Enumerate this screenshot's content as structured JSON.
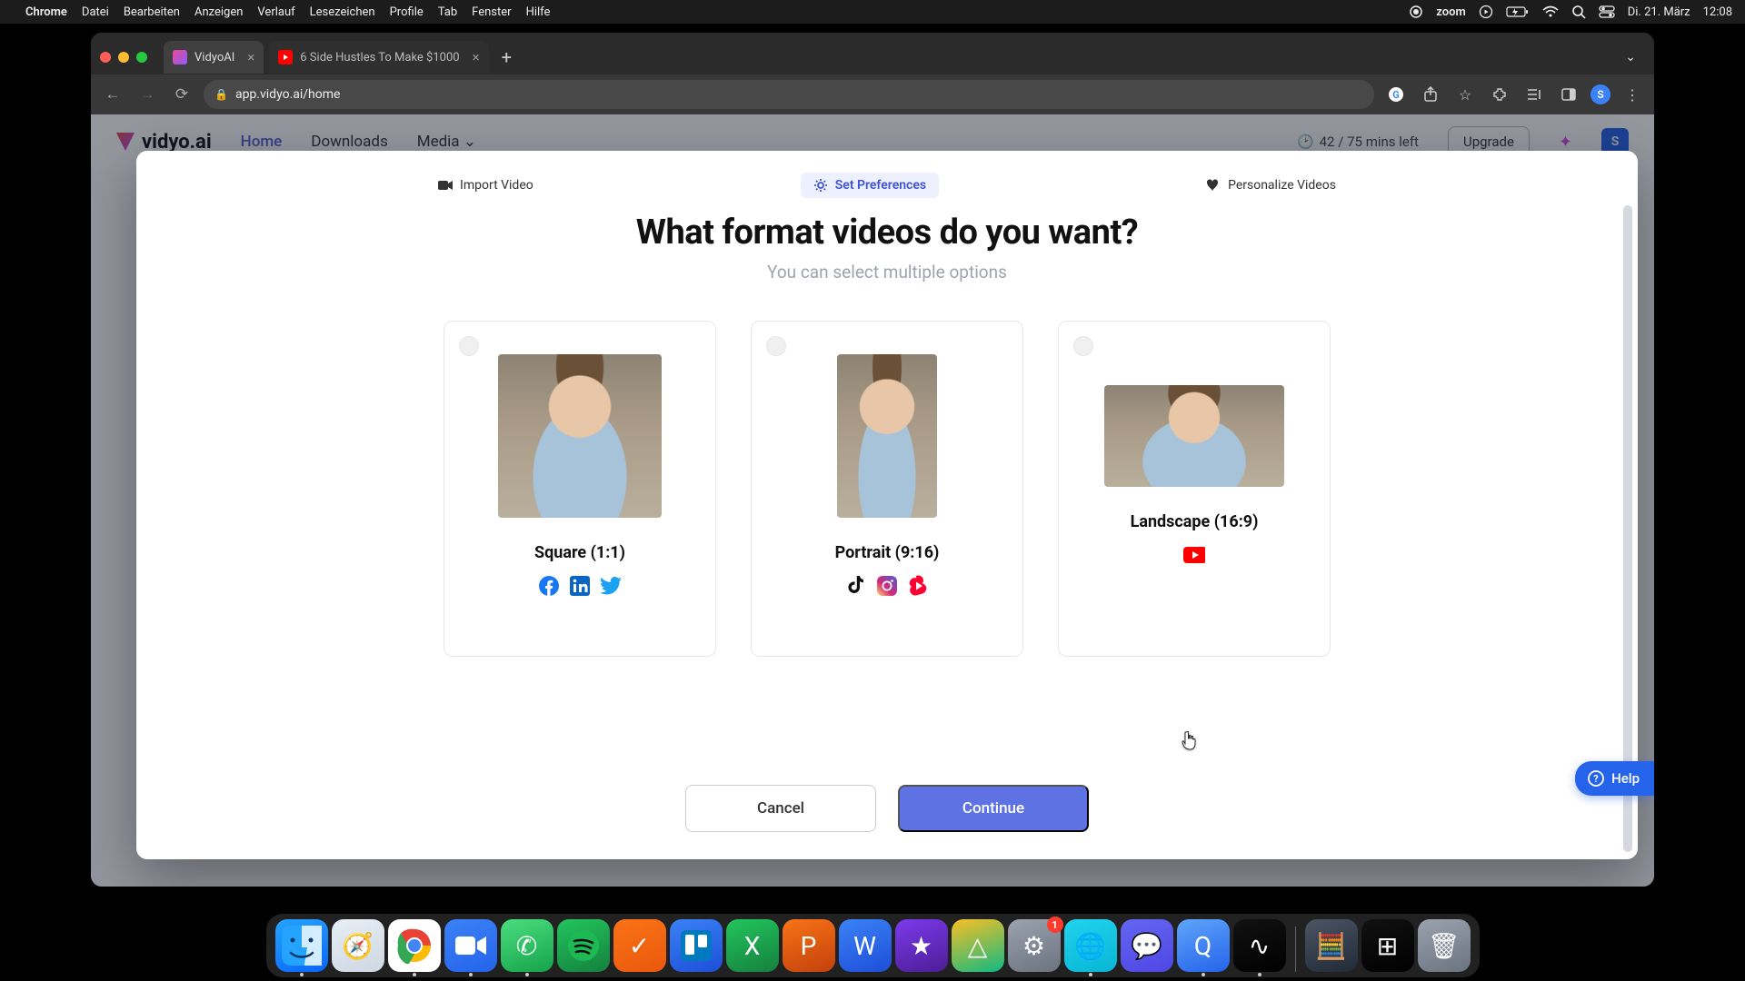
{
  "menubar": {
    "app": "Chrome",
    "items": [
      "Datei",
      "Bearbeiten",
      "Anzeigen",
      "Verlauf",
      "Lesezeichen",
      "Profile",
      "Tab",
      "Fenster",
      "Hilfe"
    ],
    "right": {
      "zoom": "zoom",
      "date": "Di. 21. März",
      "time": "12:08"
    }
  },
  "browser": {
    "tabs": [
      {
        "title": "VidyoAI"
      },
      {
        "title": "6 Side Hustles To Make $1000"
      }
    ],
    "url": "app.vidyo.ai/home",
    "avatar_initial": "S"
  },
  "app_header": {
    "brand": "vidyo.ai",
    "nav": {
      "home": "Home",
      "downloads": "Downloads",
      "media": "Media"
    },
    "mins": "42 / 75 mins left",
    "upgrade": "Upgrade",
    "avatar_initial": "S"
  },
  "modal": {
    "steps": {
      "import": "Import Video",
      "preferences": "Set Preferences",
      "personalize": "Personalize Videos"
    },
    "title": "What format videos do you want?",
    "subtitle": "You can select multiple options",
    "cards": [
      {
        "title": "Square (1:1)",
        "platforms": [
          "facebook",
          "linkedin",
          "twitter"
        ]
      },
      {
        "title": "Portrait (9:16)",
        "platforms": [
          "tiktok",
          "instagram",
          "shorts"
        ]
      },
      {
        "title": "Landscape (16:9)",
        "platforms": [
          "youtube"
        ]
      }
    ],
    "buttons": {
      "cancel": "Cancel",
      "continue": "Continue"
    }
  },
  "help": {
    "label": "Help"
  },
  "dock": {
    "apps": [
      {
        "name": "finder",
        "color1": "#24a4ff",
        "color2": "#0a66ff",
        "running": true,
        "glyph": ""
      },
      {
        "name": "safari",
        "color1": "#e9eef5",
        "color2": "#cdd7e3",
        "running": false,
        "glyph": "🧭"
      },
      {
        "name": "chrome",
        "color1": "#ffffff",
        "color2": "#ffffff",
        "running": true,
        "glyph": ""
      },
      {
        "name": "zoom",
        "color1": "#3b82f6",
        "color2": "#2563eb",
        "running": true,
        "glyph": ""
      },
      {
        "name": "whatsapp",
        "color1": "#4ade80",
        "color2": "#16a34a",
        "running": true,
        "glyph": "✆"
      },
      {
        "name": "spotify",
        "color1": "#22c55e",
        "color2": "#15803d",
        "running": false,
        "glyph": ""
      },
      {
        "name": "todoist",
        "color1": "#f97316",
        "color2": "#ea580c",
        "running": false,
        "glyph": "✓"
      },
      {
        "name": "trello",
        "color1": "#3b82f6",
        "color2": "#1d4ed8",
        "running": false,
        "glyph": ""
      },
      {
        "name": "excel",
        "color1": "#22c55e",
        "color2": "#15803d",
        "running": false,
        "glyph": "X"
      },
      {
        "name": "powerpoint",
        "color1": "#f97316",
        "color2": "#c2410c",
        "running": false,
        "glyph": "P"
      },
      {
        "name": "word",
        "color1": "#3b82f6",
        "color2": "#1d4ed8",
        "running": false,
        "glyph": "W"
      },
      {
        "name": "imovie",
        "color1": "#7c3aed",
        "color2": "#4c1d95",
        "running": false,
        "glyph": "★"
      },
      {
        "name": "drive",
        "color1": "#fbbf24",
        "color2": "#10b981",
        "running": false,
        "glyph": "△"
      },
      {
        "name": "settings",
        "color1": "#9ca3af",
        "color2": "#6b7280",
        "running": false,
        "glyph": "⚙",
        "badge": "1"
      },
      {
        "name": "globe",
        "color1": "#22d3ee",
        "color2": "#06b6d4",
        "running": true,
        "glyph": "🌐"
      },
      {
        "name": "discord",
        "color1": "#6366f1",
        "color2": "#4f46e5",
        "running": false,
        "glyph": "💬"
      },
      {
        "name": "quicktime",
        "color1": "#60a5fa",
        "color2": "#2563eb",
        "running": true,
        "glyph": "Q"
      },
      {
        "name": "audio",
        "color1": "#111111",
        "color2": "#000000",
        "running": true,
        "glyph": "∿"
      }
    ],
    "tray": [
      {
        "name": "calculator",
        "color1": "#4b5563",
        "color2": "#1f2937",
        "glyph": "🧮"
      },
      {
        "name": "mission",
        "color1": "#111111",
        "color2": "#000000",
        "glyph": "⊞"
      },
      {
        "name": "trash",
        "color1": "#9ca3af",
        "color2": "#6b7280",
        "glyph": "🗑"
      }
    ]
  }
}
